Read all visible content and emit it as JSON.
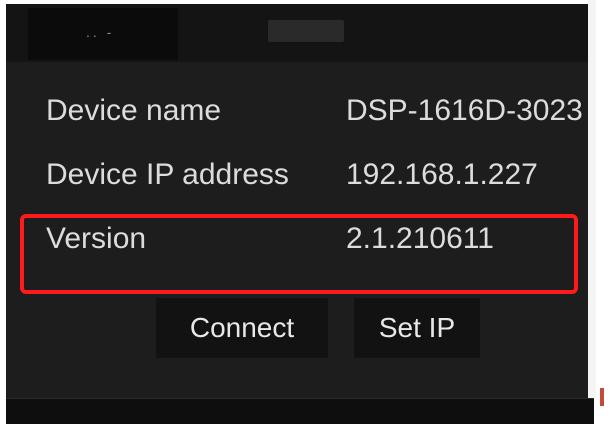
{
  "titlebar": {
    "dots": ".. -"
  },
  "rows": [
    {
      "label": "Device name",
      "value": "DSP-1616D-3023"
    },
    {
      "label": "Device IP address",
      "value": "192.168.1.227"
    },
    {
      "label": "Version",
      "value": "2.1.210611"
    }
  ],
  "buttons": {
    "connect": "Connect",
    "set_ip": "Set IP"
  },
  "colors": {
    "highlight": "#ff1b1b",
    "panel": "#1d1d1d",
    "text": "#dcdcdc"
  }
}
